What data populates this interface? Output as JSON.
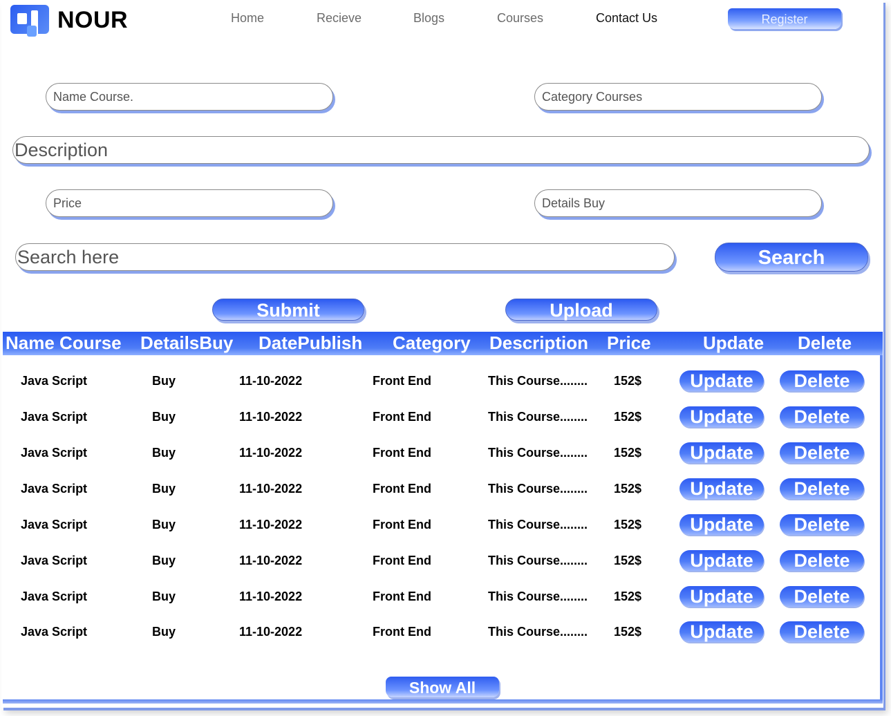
{
  "brand": {
    "name": "NOUR",
    "logo_icon": "nour-logo-icon"
  },
  "nav": {
    "items": [
      "Home",
      "Recieve",
      "Blogs",
      "Courses",
      "Contact Us"
    ],
    "active": "Contact Us",
    "register_label": "Register"
  },
  "form": {
    "name_course_placeholder": "Name Course.",
    "category_placeholder": "Category Courses",
    "description_placeholder": "Description",
    "price_placeholder": "Price",
    "details_buy_placeholder": "Details Buy",
    "search_placeholder": "Search here",
    "search_label": "Search",
    "submit_label": "Submit",
    "upload_label": "Upload"
  },
  "table": {
    "headers": [
      "Name Course",
      "DetailsBuy",
      "DatePublish",
      "Category",
      "Description",
      "Price",
      "Update",
      "Delete"
    ],
    "rows": [
      {
        "name": "Java Script",
        "details": "Buy",
        "date": "11-10-2022",
        "category": "Front End",
        "description": "This Course........",
        "price": "152$",
        "update": "Update",
        "delete": "Delete"
      },
      {
        "name": "Java Script",
        "details": "Buy",
        "date": "11-10-2022",
        "category": "Front End",
        "description": "This Course........",
        "price": "152$",
        "update": "Update",
        "delete": "Delete"
      },
      {
        "name": "Java Script",
        "details": "Buy",
        "date": "11-10-2022",
        "category": "Front End",
        "description": "This Course........",
        "price": "152$",
        "update": "Update",
        "delete": "Delete"
      },
      {
        "name": "Java Script",
        "details": "Buy",
        "date": "11-10-2022",
        "category": "Front End",
        "description": "This Course........",
        "price": "152$",
        "update": "Update",
        "delete": "Delete"
      },
      {
        "name": "Java Script",
        "details": "Buy",
        "date": "11-10-2022",
        "category": "Front End",
        "description": "This Course........",
        "price": "152$",
        "update": "Update",
        "delete": "Delete"
      },
      {
        "name": "Java Script",
        "details": "Buy",
        "date": "11-10-2022",
        "category": "Front End",
        "description": "This Course........",
        "price": "152$",
        "update": "Update",
        "delete": "Delete"
      },
      {
        "name": "Java Script",
        "details": "Buy",
        "date": "11-10-2022",
        "category": "Front End",
        "description": "This Course........",
        "price": "152$",
        "update": "Update",
        "delete": "Delete"
      },
      {
        "name": "Java Script",
        "details": "Buy",
        "date": "11-10-2022",
        "category": "Front End",
        "description": "This Course........",
        "price": "152$",
        "update": "Update",
        "delete": "Delete"
      }
    ],
    "show_all_label": "Show All"
  },
  "colors": {
    "accent": "#2f5df0",
    "accent_light": "#8fb0ff",
    "shadow": "#8aa4ee"
  }
}
